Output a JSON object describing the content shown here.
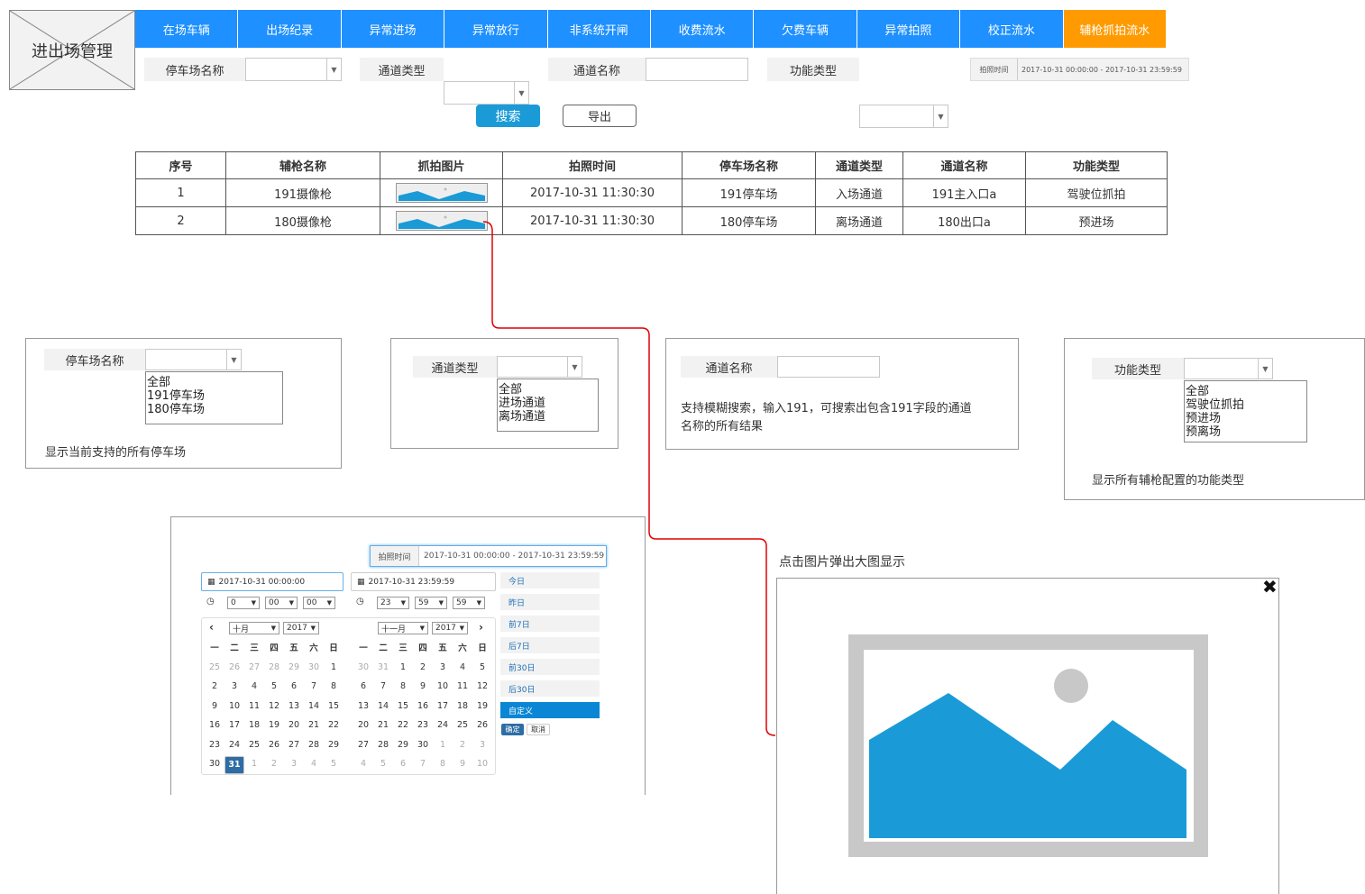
{
  "app": {
    "title": "进出场管理"
  },
  "tabs": [
    {
      "label": "在场车辆"
    },
    {
      "label": "出场纪录"
    },
    {
      "label": "异常进场"
    },
    {
      "label": "异常放行"
    },
    {
      "label": "非系统开闸"
    },
    {
      "label": "收费流水"
    },
    {
      "label": "欠费车辆"
    },
    {
      "label": "异常拍照"
    },
    {
      "label": "校正流水"
    },
    {
      "label": "辅枪抓拍流水"
    }
  ],
  "filters": {
    "parking_name": "停车场名称",
    "channel_type": "通道类型",
    "channel_name": "通道名称",
    "function_type": "功能类型",
    "photo_time_label": "拍照时间",
    "photo_time_value": "2017-10-31 00:00:00 - 2017-10-31 23:59:59"
  },
  "actions": {
    "search": "搜索",
    "export": "导出"
  },
  "table": {
    "headers": [
      "序号",
      "辅枪名称",
      "抓拍图片",
      "拍照时间",
      "停车场名称",
      "通道类型",
      "通道名称",
      "功能类型"
    ],
    "rows": [
      {
        "no": "1",
        "camera": "191摄像枪",
        "time": "2017-10-31 11:30:30",
        "parking": "191停车场",
        "ctype": "入场通道",
        "cname": "191主入口a",
        "ftype": "驾驶位抓拍"
      },
      {
        "no": "2",
        "camera": "180摄像枪",
        "time": "2017-10-31 11:30:30",
        "parking": "180停车场",
        "ctype": "离场通道",
        "cname": "180出口a",
        "ftype": "预进场"
      }
    ]
  },
  "panels": {
    "parking": {
      "label": "停车场名称",
      "options": [
        "全部",
        "191停车场",
        "180停车场"
      ],
      "note": "显示当前支持的所有停车场"
    },
    "ctype": {
      "label": "通道类型",
      "options": [
        "全部",
        "进场通道",
        "离场通道"
      ]
    },
    "cname": {
      "label": "通道名称",
      "note1": "支持模糊搜索，输入191，可搜索出包含191字段的通道",
      "note2": "名称的所有结果"
    },
    "ftype": {
      "label": "功能类型",
      "options": [
        "全部",
        "驾驶位抓拍",
        "预进场",
        "预离场"
      ],
      "note": "显示所有辅枪配置的功能类型"
    }
  },
  "datepicker": {
    "label": "拍照时间",
    "value": "2017-10-31 00:00:00 - 2017-10-31 23:59:59",
    "start": "2017-10-31 00:00:00",
    "end": "2017-10-31 23:59:59",
    "start_h": "0",
    "start_m": "00",
    "start_s": "00",
    "end_h": "23",
    "end_m": "59",
    "end_s": "59",
    "left_month": "十月",
    "left_year": "2017",
    "right_month": "十一月",
    "right_year": "2017",
    "weekdays": [
      "一",
      "二",
      "三",
      "四",
      "五",
      "六",
      "日"
    ],
    "left_days": [
      "25",
      "26",
      "27",
      "28",
      "29",
      "30",
      "1",
      "2",
      "3",
      "4",
      "5",
      "6",
      "7",
      "8",
      "9",
      "10",
      "11",
      "12",
      "13",
      "14",
      "15",
      "16",
      "17",
      "18",
      "19",
      "20",
      "21",
      "22",
      "23",
      "24",
      "25",
      "26",
      "27",
      "28",
      "29",
      "30",
      "31",
      "1",
      "2",
      "3",
      "4",
      "5"
    ],
    "right_days": [
      "30",
      "31",
      "1",
      "2",
      "3",
      "4",
      "5",
      "6",
      "7",
      "8",
      "9",
      "10",
      "11",
      "12",
      "13",
      "14",
      "15",
      "16",
      "17",
      "18",
      "19",
      "20",
      "21",
      "22",
      "23",
      "24",
      "25",
      "26",
      "27",
      "28",
      "29",
      "30",
      "1",
      "2",
      "3",
      "4",
      "5",
      "6",
      "7",
      "8",
      "9",
      "10"
    ],
    "quick": [
      "今日",
      "昨日",
      "前7日",
      "后7日",
      "前30日",
      "后30日",
      "自定义"
    ],
    "confirm": "确定",
    "cancel": "取消"
  },
  "preview": {
    "note": "点击图片弹出大图显示",
    "close": "✖"
  },
  "colors": {
    "tab": "#1e90ff",
    "tab_active": "#ff9a00",
    "accent": "#1a9bd7",
    "connector": "#e00000"
  }
}
